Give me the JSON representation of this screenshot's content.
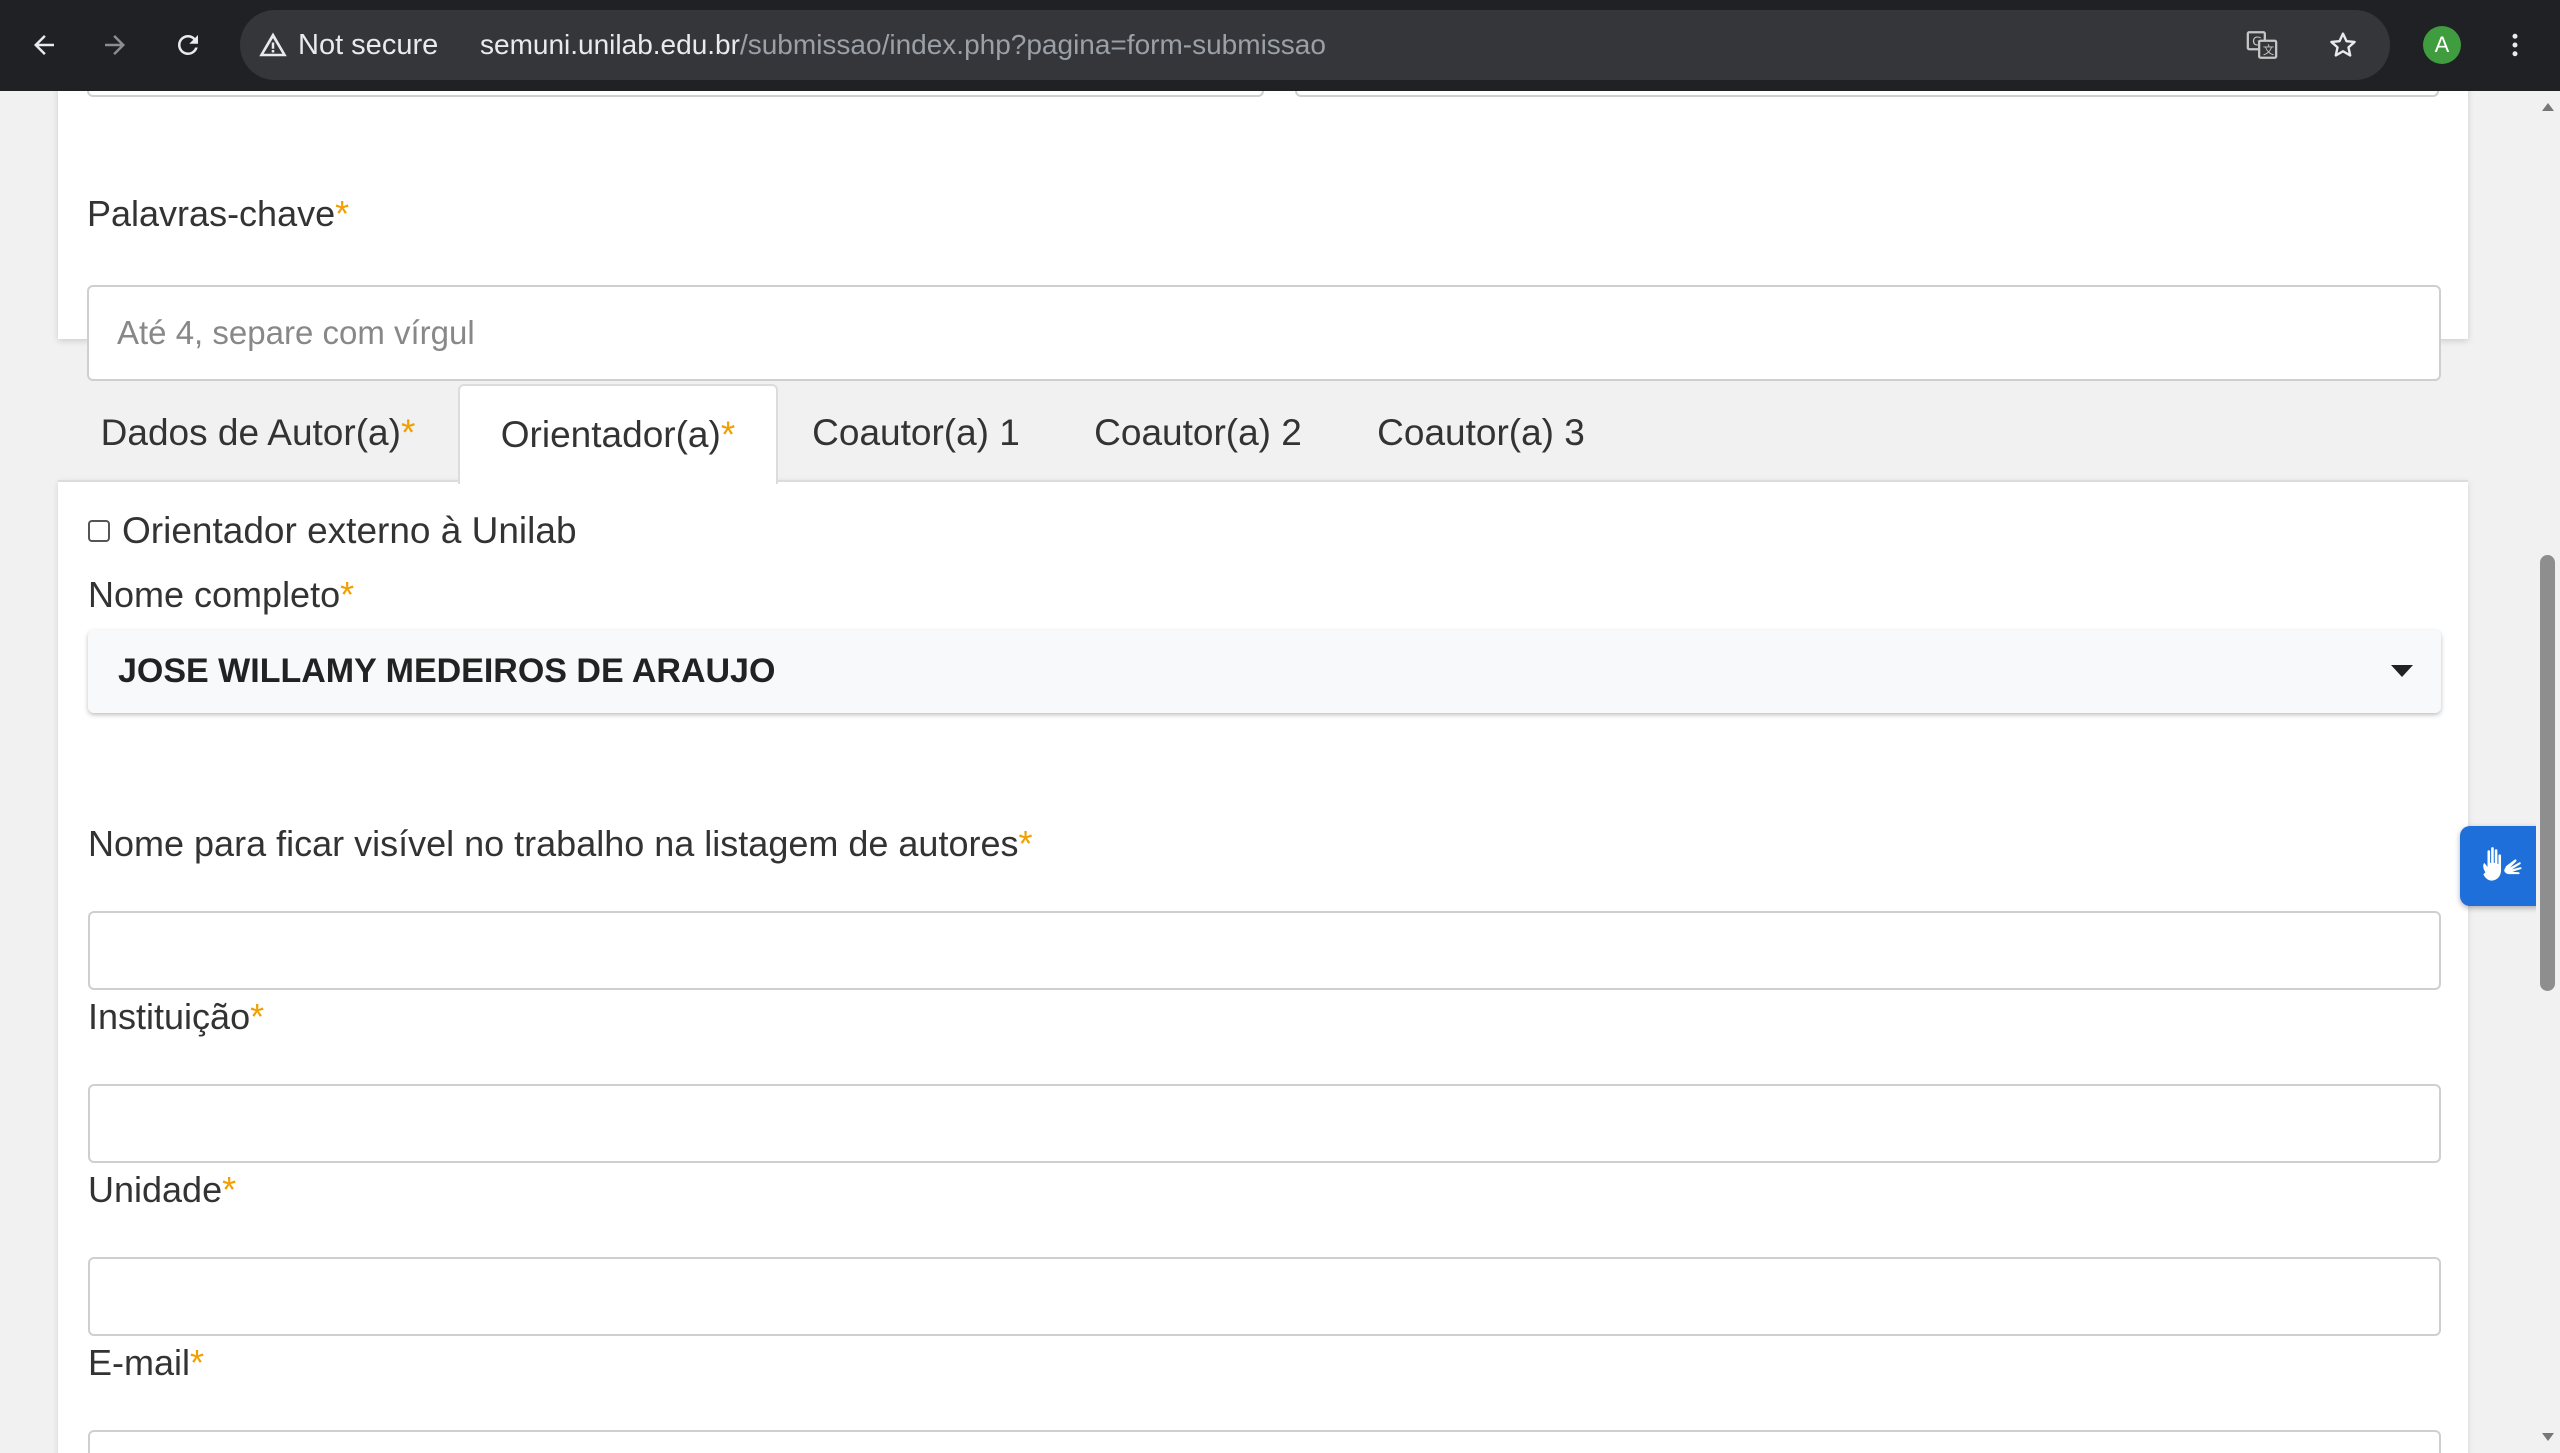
{
  "browser": {
    "security_label": "Not secure",
    "url_host": "semuni.unilab.edu.br",
    "url_path": "/submissao/index.php?pagina=form-submissao",
    "avatar_initial": "A"
  },
  "keywords": {
    "label": "Palavras-chave",
    "required_mark": "*",
    "placeholder": "Até 4, separe com vírgul",
    "value": ""
  },
  "tabs": [
    {
      "label": "Dados de Autor(a)",
      "required": "*",
      "active": false
    },
    {
      "label": "Orientador(a)",
      "required": "*",
      "active": true
    },
    {
      "label": "Coautor(a) 1",
      "required": "",
      "active": false
    },
    {
      "label": "Coautor(a) 2",
      "required": "",
      "active": false
    },
    {
      "label": "Coautor(a) 3",
      "required": "",
      "active": false
    }
  ],
  "advisor_form": {
    "external_checkbox_label": "Orientador externo à Unilab",
    "external_checked": false,
    "full_name_label": "Nome completo",
    "full_name_value": "JOSE WILLAMY MEDEIROS DE ARAUJO",
    "display_name_label": "Nome para ficar visível no trabalho na listagem de autores",
    "display_name_value": "",
    "institution_label": "Instituição",
    "institution_value": "",
    "unit_label": "Unidade",
    "unit_value": "",
    "email_label": "E-mail",
    "email_value": "",
    "required_mark": "*"
  },
  "colors": {
    "required": "#f0a000",
    "accessibility_widget": "#1e6fd9",
    "chrome_bg": "#202124"
  },
  "icons": {
    "back": "arrow-left-icon",
    "forward": "arrow-right-icon",
    "reload": "reload-icon",
    "warning": "warning-triangle-icon",
    "translate": "translate-icon",
    "bookmark": "star-icon",
    "menu": "kebab-menu-icon",
    "accessibility": "sign-language-hands-icon",
    "dropdown": "caret-down-icon"
  }
}
